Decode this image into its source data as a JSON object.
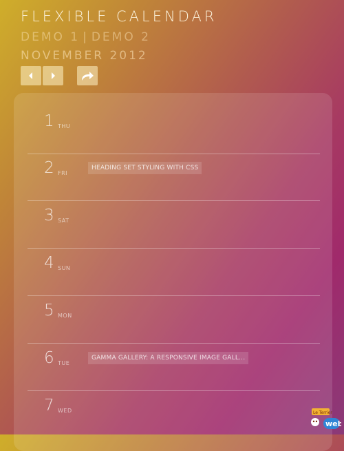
{
  "header": {
    "title": "FLEXIBLE CALENDAR",
    "demo1": "DEMO 1",
    "separator": "|",
    "demo2": "DEMO 2",
    "month": "NOVEMBER 2012"
  },
  "nav": {
    "prev_icon": "chevron-left-icon",
    "next_icon": "chevron-right-icon",
    "share_icon": "share-arrow-icon"
  },
  "days": [
    {
      "num": "1",
      "dow": "THU",
      "event": ""
    },
    {
      "num": "2",
      "dow": "FRI",
      "event": "HEADING SET STYLING WITH CSS"
    },
    {
      "num": "3",
      "dow": "SAT",
      "event": ""
    },
    {
      "num": "4",
      "dow": "SUN",
      "event": ""
    },
    {
      "num": "5",
      "dow": "MON",
      "event": ""
    },
    {
      "num": "6",
      "dow": "TUE",
      "event": "GAMMA GALLERY: A RESPONSIVE IMAGE GALL..."
    },
    {
      "num": "7",
      "dow": "WED",
      "event": ""
    }
  ],
  "watermark": {
    "text": "Le Terrier du Web"
  }
}
